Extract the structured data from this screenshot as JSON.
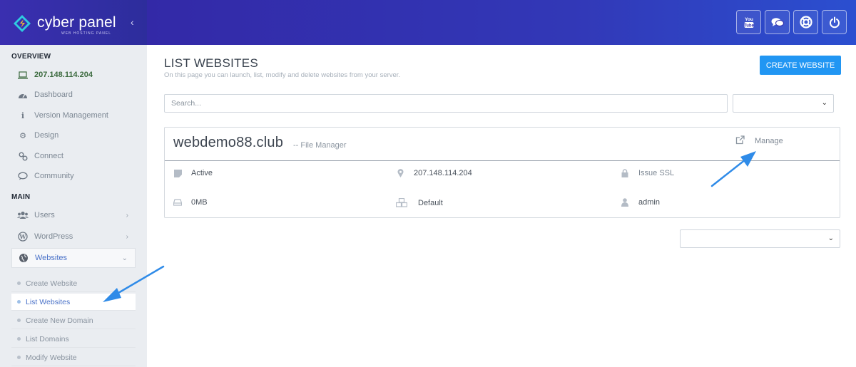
{
  "brand": {
    "name": "cyber panel",
    "tagline": "WEB HOSTING PANEL"
  },
  "sidebar": {
    "overview_title": "OVERVIEW",
    "ip": "207.148.114.204",
    "overview_items": [
      {
        "label": "Dashboard",
        "icon": "dashboard-icon"
      },
      {
        "label": "Version Management",
        "icon": "info-icon"
      },
      {
        "label": "Design",
        "icon": "gear-icon"
      },
      {
        "label": "Connect",
        "icon": "link-icon"
      },
      {
        "label": "Community",
        "icon": "chat-icon"
      }
    ],
    "main_title": "MAIN",
    "main_items": [
      {
        "label": "Users",
        "icon": "users-icon"
      },
      {
        "label": "WordPress",
        "icon": "wordpress-icon"
      },
      {
        "label": "Websites",
        "icon": "globe-icon"
      }
    ],
    "websites_sub": [
      {
        "label": "Create Website"
      },
      {
        "label": "List Websites"
      },
      {
        "label": "Create New Domain"
      },
      {
        "label": "List Domains"
      },
      {
        "label": "Modify Website"
      }
    ]
  },
  "header": {
    "buttons": [
      "youtube-icon",
      "chat-icon",
      "lifebuoy-icon",
      "power-icon"
    ]
  },
  "main": {
    "title": "LIST WEBSITES",
    "description": "On this page you can launch, list, modify and delete websites from your server.",
    "create_button": "CREATE WEBSITE",
    "search_placeholder": "Search...",
    "website": {
      "domain": "webdemo88.club",
      "file_manager": "-- File Manager",
      "manage": "Manage",
      "status": "Active",
      "ip": "207.148.114.204",
      "ssl": "Issue SSL",
      "disk": "0MB",
      "package": "Default",
      "owner": "admin"
    }
  },
  "colors": {
    "header": "#3329a7",
    "accent": "#2196f3",
    "annotation_arrow": "#2f8be8"
  }
}
